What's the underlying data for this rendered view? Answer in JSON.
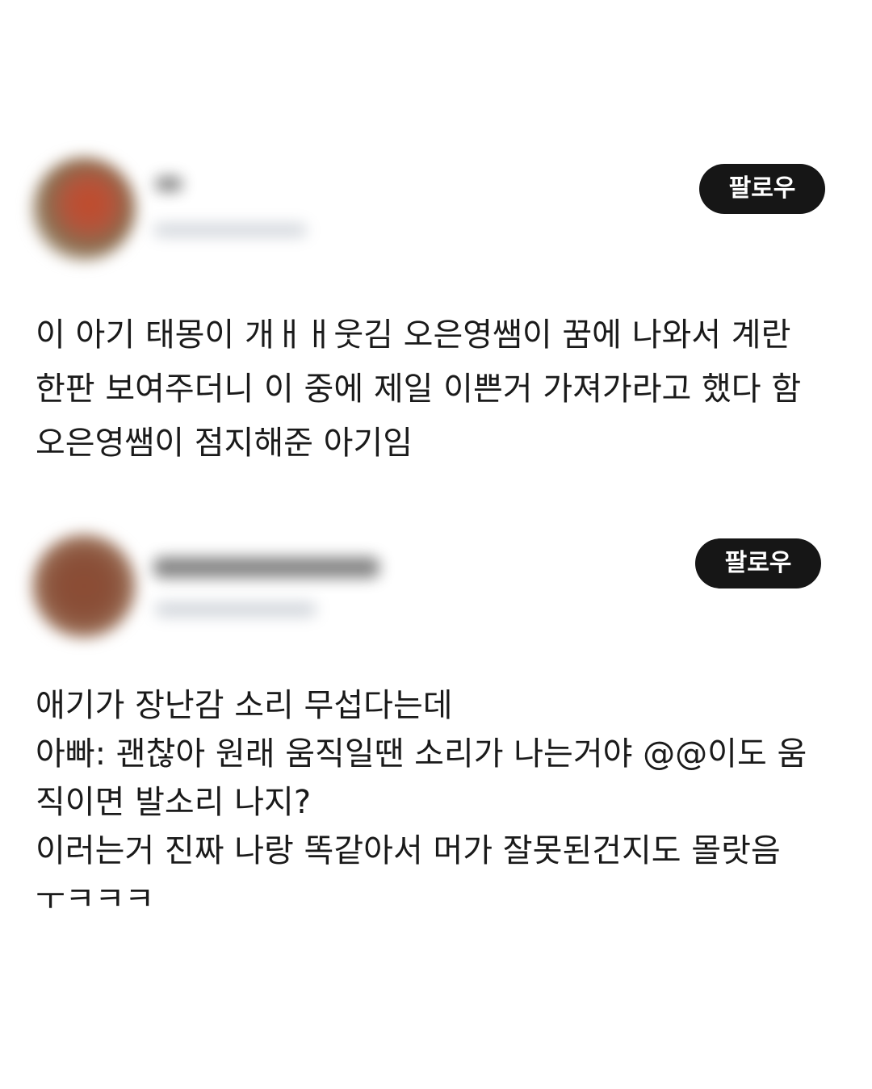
{
  "posts": [
    {
      "follow_label": "팔로우",
      "lines": [
        "이 아기 태몽이 개ㅐㅐ웃김 오은영쌤이 꿈에 나와서 계란",
        "한판 보여주더니 이 중에 제일 이쁜거 가져가라고 했다 함",
        "오은영쌤이 점지해준 아기임"
      ]
    },
    {
      "follow_label": "팔로우",
      "lines": [
        "애기가 장난감 소리 무섭다는데",
        "아빠: 괜찮아 원래 움직일땐 소리가 나는거야 @@이도 움",
        "직이면 발소리 나지?",
        "이러는거 진짜 나랑 똑같아서 머가 잘못된건지도 몰랏음",
        "ㅜㅋㅋㅋ"
      ]
    }
  ]
}
